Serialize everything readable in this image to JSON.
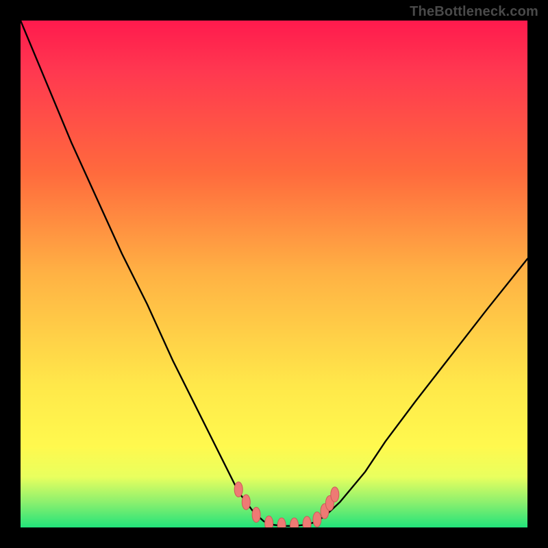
{
  "attribution": "TheBottleneck.com",
  "colors": {
    "frame": "#000000",
    "curve": "#000000",
    "marker_fill": "#ee7a74",
    "marker_stroke": "#cc5a58",
    "gradient_stops": [
      "#ff1a4d",
      "#ff3850",
      "#ff6a3d",
      "#ffb244",
      "#ffe84a",
      "#fff94e",
      "#e9ff5e",
      "#8cf06e",
      "#22e37a"
    ]
  },
  "chart_data": {
    "type": "line",
    "title": "",
    "xlabel": "",
    "ylabel": "",
    "xlim": [
      0,
      100
    ],
    "ylim": [
      0,
      100
    ],
    "grid": false,
    "legend": false,
    "series": [
      {
        "name": "bottleneck-curve",
        "x": [
          0,
          5,
          10,
          15,
          20,
          25,
          30,
          35,
          40,
          43,
          46,
          48,
          50,
          52,
          54,
          56,
          58,
          60,
          63,
          68,
          72,
          78,
          85,
          92,
          100
        ],
        "y": [
          100,
          88,
          76,
          65,
          54,
          44,
          33,
          23,
          13,
          7,
          3,
          1.2,
          0.5,
          0.3,
          0.3,
          0.5,
          1.0,
          2.2,
          5,
          11,
          17,
          25,
          34,
          43,
          53
        ]
      }
    ],
    "markers": {
      "name": "highlighted-points",
      "style": "pill",
      "points": [
        {
          "x": 43.0,
          "y": 7.5
        },
        {
          "x": 44.5,
          "y": 5.0
        },
        {
          "x": 46.5,
          "y": 2.5
        },
        {
          "x": 49.0,
          "y": 0.8
        },
        {
          "x": 51.5,
          "y": 0.4
        },
        {
          "x": 54.0,
          "y": 0.4
        },
        {
          "x": 56.5,
          "y": 0.7
        },
        {
          "x": 58.5,
          "y": 1.6
        },
        {
          "x": 60.0,
          "y": 3.2
        },
        {
          "x": 61.0,
          "y": 4.8
        },
        {
          "x": 62.0,
          "y": 6.5
        }
      ]
    }
  }
}
